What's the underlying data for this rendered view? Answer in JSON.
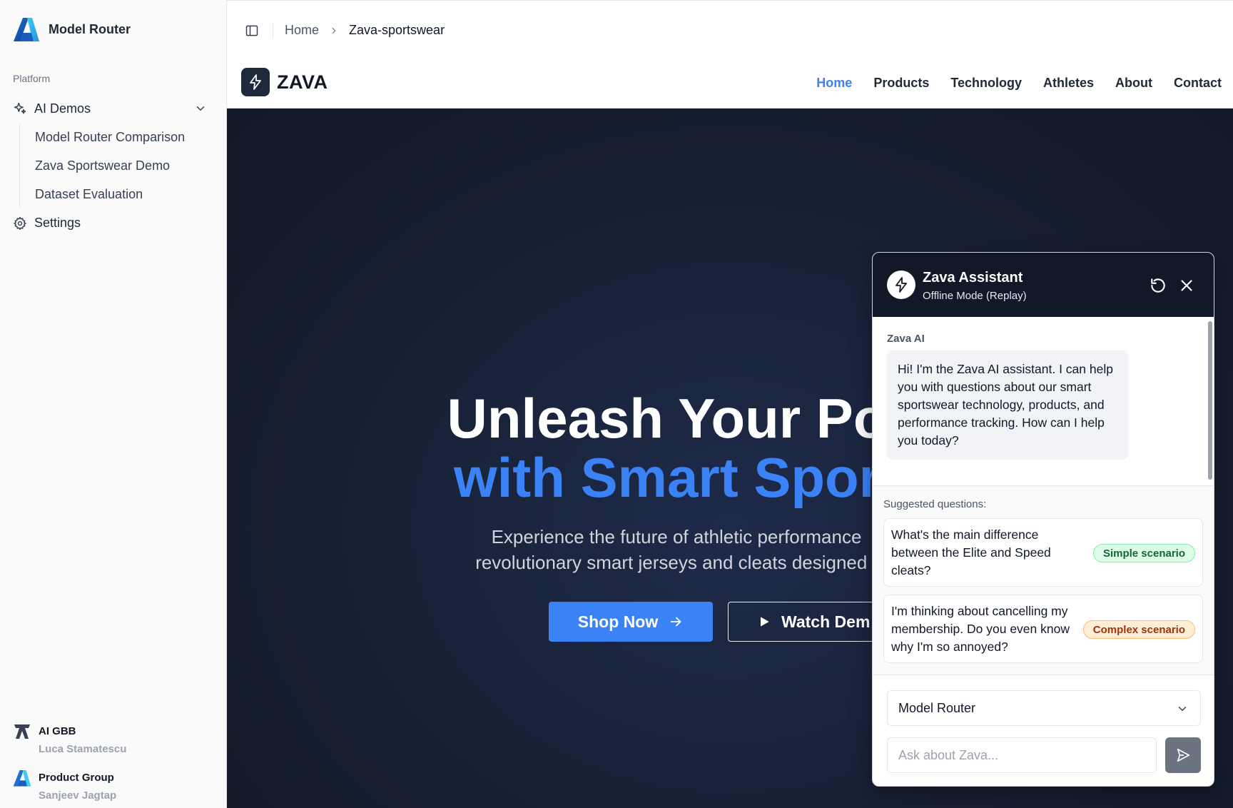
{
  "sidebar": {
    "brand": "Model Router",
    "section_label": "Platform",
    "group": {
      "label": "AI Demos",
      "icon": "sparkles-icon"
    },
    "sub_items": [
      {
        "label": "Model Router Comparison"
      },
      {
        "label": "Zava Sportswear Demo"
      },
      {
        "label": "Dataset Evaluation"
      }
    ],
    "settings_label": "Settings",
    "users": [
      {
        "org": "AI GBB",
        "name": "Luca Stamatescu"
      },
      {
        "org": "Product Group",
        "name": "Sanjeev Jagtap"
      }
    ]
  },
  "breadcrumb": {
    "home": "Home",
    "current": "Zava-sportswear"
  },
  "site": {
    "logo_text": "ZAVA",
    "nav": [
      {
        "label": "Home",
        "active": true
      },
      {
        "label": "Products"
      },
      {
        "label": "Technology"
      },
      {
        "label": "Athletes"
      },
      {
        "label": "About"
      },
      {
        "label": "Contact"
      }
    ]
  },
  "hero": {
    "title_line1": "Unleash Your Pot",
    "title_line2": "with Smart Sport",
    "subtitle_line1": "Experience the future of athletic performance",
    "subtitle_line2": "revolutionary smart jerseys and cleats designed f",
    "shop_label": "Shop Now",
    "watch_label": "Watch Dem"
  },
  "chat": {
    "title": "Zava Assistant",
    "status": "Offline Mode (Replay)",
    "sender": "Zava AI",
    "greeting": "Hi! I'm the Zava AI assistant. I can help you with questions about our smart sportswear technology, products, and performance tracking. How can I help you today?",
    "suggested_label": "Suggested questions:",
    "suggestions": [
      {
        "text": "What's the main difference between the Elite and Speed cleats?",
        "tag": "Simple scenario"
      },
      {
        "text": "I'm thinking about cancelling my membership. Do you even know why I'm so annoyed?",
        "tag": "Complex scenario"
      }
    ],
    "model_selected": "Model Router",
    "input_placeholder": "Ask about Zava..."
  },
  "colors": {
    "accent": "#3b82f6",
    "hero_bg": "#172033",
    "chat_header": "#111827",
    "simple_tag": "#dcfce7",
    "complex_tag": "#ffedd5"
  }
}
